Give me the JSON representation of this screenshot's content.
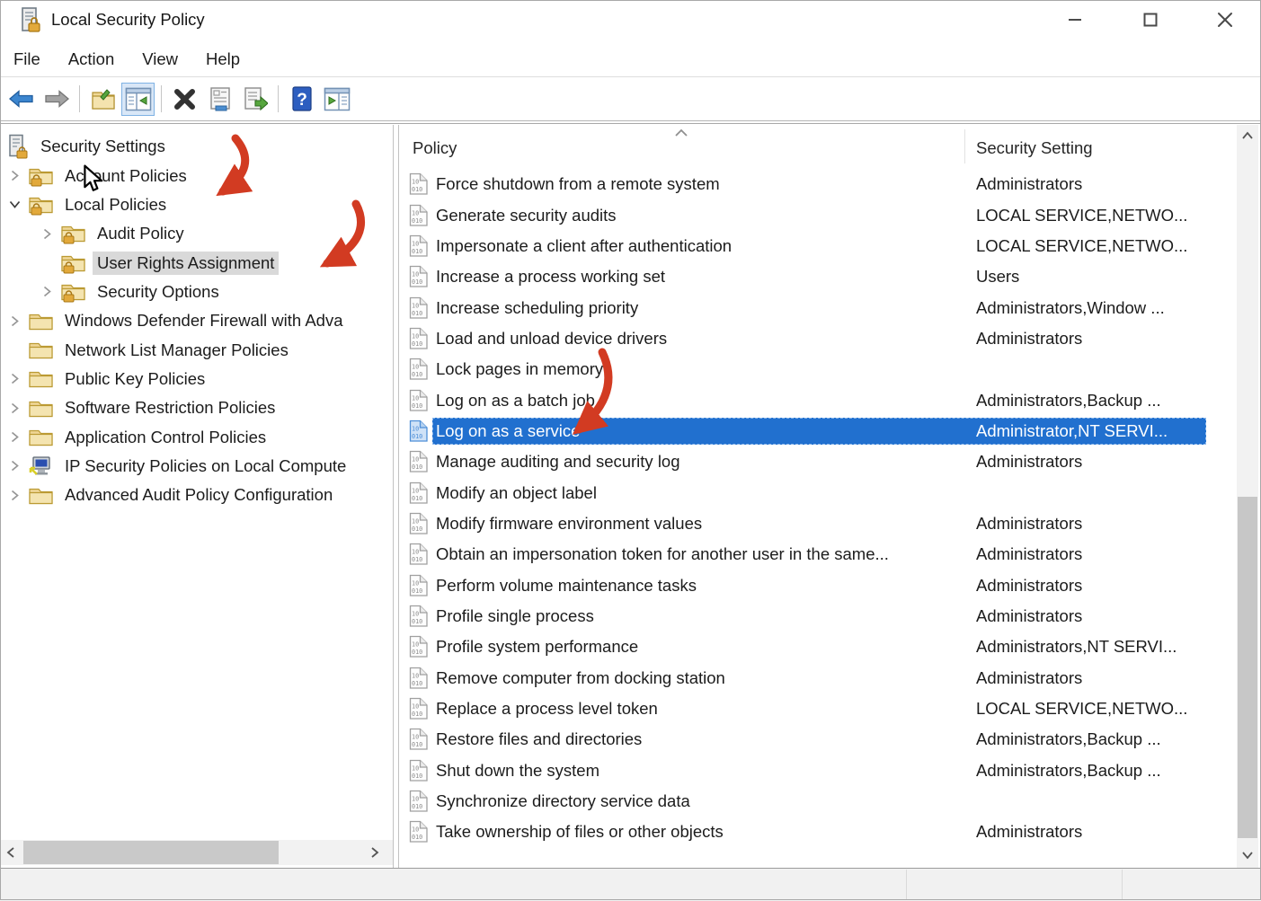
{
  "window": {
    "title": "Local Security Policy",
    "controls": {
      "minimize": "minimize",
      "maximize": "maximize",
      "close": "close"
    }
  },
  "menu": {
    "items": [
      {
        "label": "File"
      },
      {
        "label": "Action"
      },
      {
        "label": "View"
      },
      {
        "label": "Help"
      }
    ]
  },
  "toolbar": {
    "buttons": [
      {
        "icon": "back-arrow-icon",
        "active": false
      },
      {
        "icon": "forward-arrow-icon",
        "active": false
      },
      {
        "icon": "console-window-icon",
        "active": false
      },
      {
        "icon": "show-hide-console-tree-icon",
        "active": true
      },
      {
        "icon": "delete-x-icon",
        "active": false
      },
      {
        "icon": "properties-icon",
        "active": false
      },
      {
        "icon": "export-list-icon",
        "active": false
      },
      {
        "icon": "help-icon",
        "active": false
      },
      {
        "icon": "show-hide-action-pane-icon",
        "active": false
      }
    ]
  },
  "sidebar": {
    "items": [
      {
        "label": "Security Settings",
        "level": 0,
        "icon": "root",
        "expand": "none",
        "selected": false
      },
      {
        "label": "Account Policies",
        "level": 1,
        "icon": "folder-lock",
        "expand": "collapsed",
        "selected": false
      },
      {
        "label": "Local Policies",
        "level": 1,
        "icon": "folder-lock",
        "expand": "expanded",
        "selected": false
      },
      {
        "label": "Audit Policy",
        "level": 2,
        "icon": "folder-lock",
        "expand": "collapsed",
        "selected": false
      },
      {
        "label": "User Rights Assignment",
        "level": 2,
        "icon": "folder-lock",
        "expand": "none",
        "selected": true
      },
      {
        "label": "Security Options",
        "level": 2,
        "icon": "folder-lock",
        "expand": "collapsed",
        "selected": false
      },
      {
        "label": "Windows Defender Firewall with Adva",
        "level": 1,
        "icon": "folder",
        "expand": "collapsed",
        "selected": false
      },
      {
        "label": "Network List Manager Policies",
        "level": 1,
        "icon": "folder",
        "expand": "none",
        "selected": false
      },
      {
        "label": "Public Key Policies",
        "level": 1,
        "icon": "folder",
        "expand": "collapsed",
        "selected": false
      },
      {
        "label": "Software Restriction Policies",
        "level": 1,
        "icon": "folder",
        "expand": "collapsed",
        "selected": false
      },
      {
        "label": "Application Control Policies",
        "level": 1,
        "icon": "folder",
        "expand": "collapsed",
        "selected": false
      },
      {
        "label": "IP Security Policies on Local Compute",
        "level": 1,
        "icon": "computer",
        "expand": "collapsed",
        "selected": false
      },
      {
        "label": "Advanced Audit Policy Configuration",
        "level": 1,
        "icon": "folder",
        "expand": "collapsed",
        "selected": false
      }
    ]
  },
  "main": {
    "columns": [
      {
        "label": "Policy",
        "sort": "ascending"
      },
      {
        "label": "Security Setting",
        "sort": "none"
      }
    ],
    "rows": [
      {
        "policy": "Force shutdown from a remote system",
        "setting": "Administrators",
        "selected": false
      },
      {
        "policy": "Generate security audits",
        "setting": "LOCAL SERVICE,NETWO...",
        "selected": false
      },
      {
        "policy": "Impersonate a client after authentication",
        "setting": "LOCAL SERVICE,NETWO...",
        "selected": false
      },
      {
        "policy": "Increase a process working set",
        "setting": "Users",
        "selected": false
      },
      {
        "policy": "Increase scheduling priority",
        "setting": "Administrators,Window ...",
        "selected": false
      },
      {
        "policy": "Load and unload device drivers",
        "setting": "Administrators",
        "selected": false
      },
      {
        "policy": "Lock pages in memory",
        "setting": "",
        "selected": false
      },
      {
        "policy": "Log on as a batch job",
        "setting": "Administrators,Backup ...",
        "selected": false
      },
      {
        "policy": "Log on as a service",
        "setting": "Administrator,NT SERVI...",
        "selected": true
      },
      {
        "policy": "Manage auditing and security log",
        "setting": "Administrators",
        "selected": false
      },
      {
        "policy": "Modify an object label",
        "setting": "",
        "selected": false
      },
      {
        "policy": "Modify firmware environment values",
        "setting": "Administrators",
        "selected": false
      },
      {
        "policy": "Obtain an impersonation token for another user in the same...",
        "setting": "Administrators",
        "selected": false
      },
      {
        "policy": "Perform volume maintenance tasks",
        "setting": "Administrators",
        "selected": false
      },
      {
        "policy": "Profile single process",
        "setting": "Administrators",
        "selected": false
      },
      {
        "policy": "Profile system performance",
        "setting": "Administrators,NT SERVI...",
        "selected": false
      },
      {
        "policy": "Remove computer from docking station",
        "setting": "Administrators",
        "selected": false
      },
      {
        "policy": "Replace a process level token",
        "setting": "LOCAL SERVICE,NETWO...",
        "selected": false
      },
      {
        "policy": "Restore files and directories",
        "setting": "Administrators,Backup ...",
        "selected": false
      },
      {
        "policy": "Shut down the system",
        "setting": "Administrators,Backup ...",
        "selected": false
      },
      {
        "policy": "Synchronize directory service data",
        "setting": "",
        "selected": false
      },
      {
        "policy": "Take ownership of files or other objects",
        "setting": "Administrators",
        "selected": false
      }
    ]
  },
  "annotations": {
    "arrow_color": "#d23b22",
    "arrows": [
      {
        "points_to": "Local Policies"
      },
      {
        "points_to": "User Rights Assignment"
      },
      {
        "points_to": "Log on as a service"
      }
    ]
  },
  "colors": {
    "selection_blue": "#2170cf",
    "tree_selection_gray": "#d9d9d9",
    "toolbar_active_bg": "#d9e7f7",
    "statusbar_bg": "#f1f1f1"
  }
}
